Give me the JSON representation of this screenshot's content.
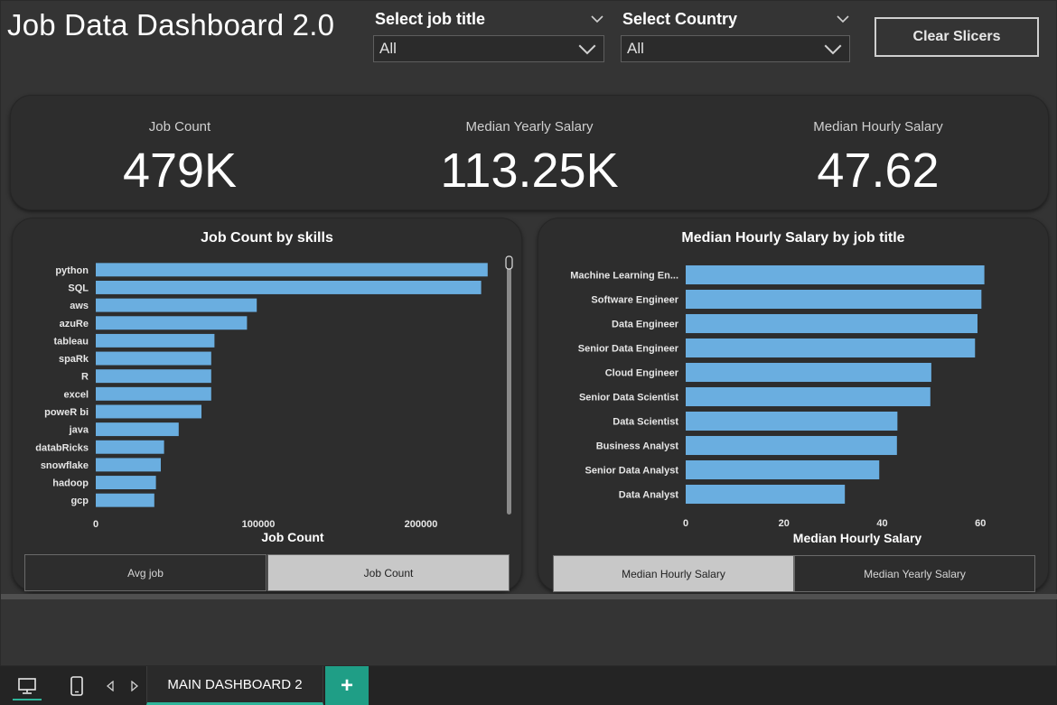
{
  "dashboard": {
    "title": "Job Data Dashboard 2.0",
    "slicers": [
      {
        "label": "Select job title",
        "value": "All"
      },
      {
        "label": "Select Country",
        "value": "All"
      }
    ],
    "clear_button": "Clear Slicers"
  },
  "kpis": [
    {
      "label": "Job Count",
      "value": "479K"
    },
    {
      "label": "Median Yearly Salary",
      "value": "113.25K"
    },
    {
      "label": "Median Hourly Salary",
      "value": "47.62"
    }
  ],
  "panel_left": {
    "toggles": [
      {
        "label": "Avg job",
        "active": false
      },
      {
        "label": "Job Count",
        "active": true
      }
    ]
  },
  "panel_right": {
    "toggles": [
      {
        "label": "Median Hourly Salary",
        "active": true
      },
      {
        "label": "Median Yearly Salary",
        "active": false
      }
    ]
  },
  "chart_data": [
    {
      "type": "bar",
      "orientation": "horizontal",
      "title": "Job Count by skills",
      "xlabel": "Job Count",
      "ylabel": "",
      "categories": [
        "python",
        "SQL",
        "aws",
        "azuRe",
        "tableau",
        "spaRk",
        "R",
        "excel",
        "poweR bi",
        "java",
        "databRicks",
        "snowflake",
        "hadoop",
        "gcp"
      ],
      "values": [
        241000,
        237000,
        99000,
        93000,
        73000,
        71000,
        71000,
        71000,
        65000,
        51000,
        42000,
        40000,
        37000,
        36000
      ],
      "xlim": [
        0,
        250000
      ],
      "xticks": [
        "0",
        "100000",
        "200000"
      ],
      "xtick_values": [
        0,
        100000,
        200000
      ],
      "bar_color": "#6aaee0",
      "grid": false
    },
    {
      "type": "bar",
      "orientation": "horizontal",
      "title": "Median Hourly Salary by job title",
      "xlabel": "Median Hourly Salary",
      "ylabel": "",
      "categories": [
        "Machine Learning En...",
        "Software Engineer",
        "Data Engineer",
        "Senior Data Engineer",
        "Cloud Engineer",
        "Senior Data Scientist",
        "Data Scientist",
        "Business Analyst",
        "Senior Data Analyst",
        "Data Analyst"
      ],
      "values": [
        60.8,
        60.2,
        59.4,
        58.9,
        50.0,
        49.8,
        43.1,
        43.0,
        39.4,
        32.4
      ],
      "xlim": [
        0,
        64
      ],
      "xticks": [
        "0",
        "20",
        "40",
        "60"
      ],
      "xtick_values": [
        0,
        20,
        40,
        60
      ],
      "bar_color": "#6aaee0",
      "grid": false
    }
  ],
  "footer": {
    "page_tab": "MAIN DASHBOARD 2",
    "add_label": "+"
  }
}
